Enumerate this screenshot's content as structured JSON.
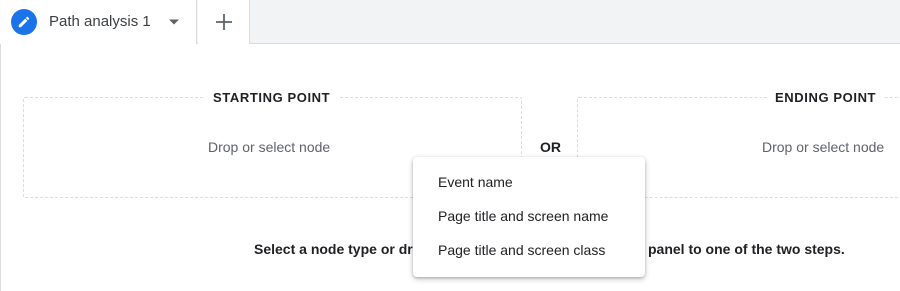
{
  "tabs": [
    {
      "label": "Path analysis 1",
      "icon": "edit-icon",
      "dropdown_icon": "arrow-drop-down-icon"
    }
  ],
  "add_tab_icon": "plus-icon",
  "starting_point": {
    "title": "STARTING POINT",
    "placeholder": "Drop or select node"
  },
  "or_label": "OR",
  "ending_point": {
    "title": "ENDING POINT",
    "placeholder": "Drop or select node"
  },
  "instruction": {
    "left_text": "Select a node type or dr",
    "right_text": "panel to one of the two steps."
  },
  "menu": {
    "items": [
      "Event name",
      "Page title and screen name",
      "Page title and screen class"
    ]
  },
  "colors": {
    "accent": "#1a73e8",
    "tabbar_bg": "#f1f3f4",
    "border": "#dadce0"
  }
}
